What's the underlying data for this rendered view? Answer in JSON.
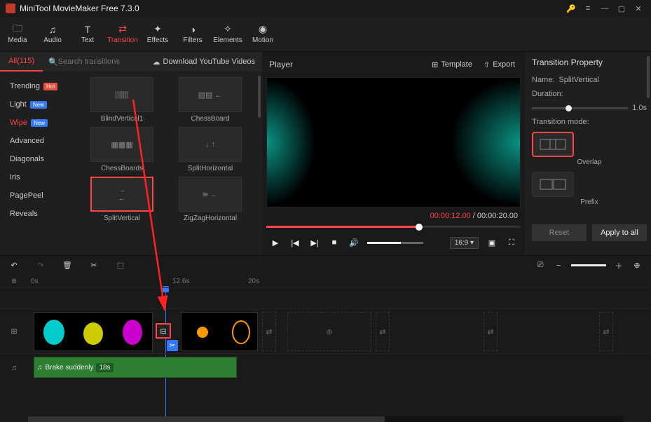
{
  "app": {
    "title": "MiniTool MovieMaker Free 7.3.0"
  },
  "nav": {
    "items": [
      {
        "label": "Media",
        "icon": "folder-icon"
      },
      {
        "label": "Audio",
        "icon": "music-icon"
      },
      {
        "label": "Text",
        "icon": "text-icon"
      },
      {
        "label": "Transition",
        "icon": "transition-icon",
        "active": true
      },
      {
        "label": "Effects",
        "icon": "effects-icon"
      },
      {
        "label": "Filters",
        "icon": "filters-icon"
      },
      {
        "label": "Elements",
        "icon": "elements-icon"
      },
      {
        "label": "Motion",
        "icon": "motion-icon"
      }
    ]
  },
  "subbar": {
    "all_label": "All(115)",
    "search_placeholder": "Search transitions",
    "download_label": "Download YouTube Videos"
  },
  "categories": [
    {
      "label": "Trending",
      "badge": "Hot"
    },
    {
      "label": "Light",
      "badge": "New",
      "blue": true
    },
    {
      "label": "Wipe",
      "badge": "New",
      "blue": true,
      "active": true
    },
    {
      "label": "Advanced"
    },
    {
      "label": "Diagonals"
    },
    {
      "label": "Iris"
    },
    {
      "label": "PagePeel"
    },
    {
      "label": "Reveals"
    }
  ],
  "transitions": [
    {
      "name": "BlindVertical1"
    },
    {
      "name": "ChessBoard"
    },
    {
      "name": "ChessBoards"
    },
    {
      "name": "SplitHorizontal"
    },
    {
      "name": "SplitVertical",
      "selected": true
    },
    {
      "name": "ZigZagHorizontal"
    }
  ],
  "player": {
    "title": "Player",
    "template_label": "Template",
    "export_label": "Export",
    "time_current": "00:00:12.00",
    "time_total": "00:00:20.00",
    "aspect": "16:9"
  },
  "property": {
    "title": "Transition Property",
    "name_label": "Name:",
    "name_value": "SplitVertical",
    "duration_label": "Duration:",
    "duration_value": "1.0s",
    "mode_label": "Transition mode:",
    "mode_overlap": "Overlap",
    "mode_prefix": "Prefix",
    "reset_label": "Reset",
    "apply_label": "Apply to all"
  },
  "timeline": {
    "ruler": {
      "t0": "0s",
      "t1": "12.6s",
      "t2": "20s"
    },
    "audio_clip_name": "Brake suddenly",
    "audio_clip_dur": "18s"
  }
}
